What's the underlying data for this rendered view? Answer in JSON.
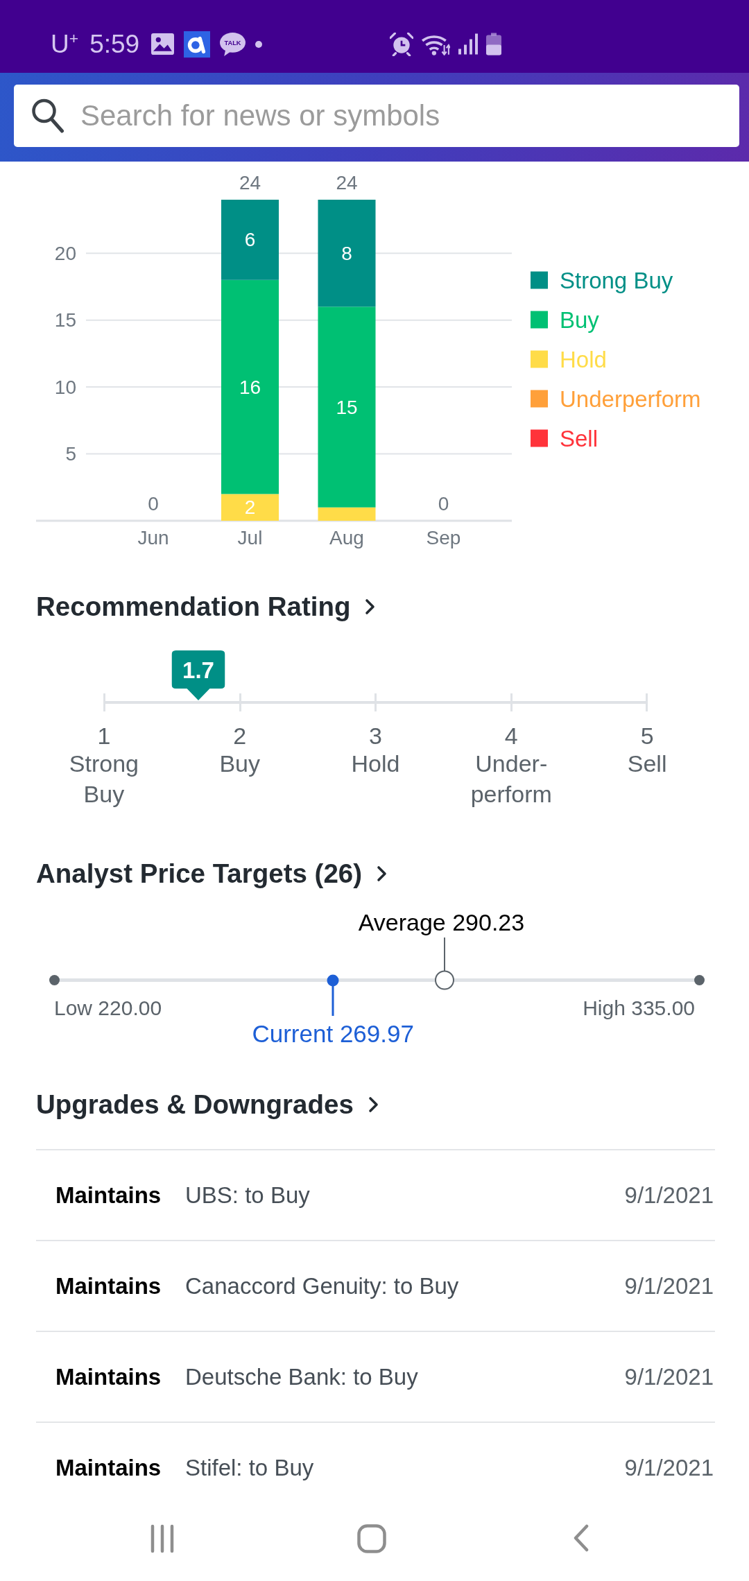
{
  "status_bar": {
    "carrier": "U$^{+}$",
    "time": "5:59",
    "chat_badge": "TALK"
  },
  "search": {
    "placeholder": "Search for news or symbols"
  },
  "recommendation_trends": {
    "totals": [
      "0",
      "24",
      "24",
      "0"
    ],
    "chart_data": {
      "type": "bar",
      "categories": [
        "Jun",
        "Jul",
        "Aug",
        "Sep"
      ],
      "series": [
        {
          "name": "Strong Buy",
          "color": "#008f86",
          "values": [
            0,
            6,
            8,
            0
          ]
        },
        {
          "name": "Buy",
          "color": "#00c073",
          "values": [
            0,
            16,
            15,
            0
          ]
        },
        {
          "name": "Hold",
          "color": "#ffdc48",
          "values": [
            0,
            2,
            1,
            0
          ]
        },
        {
          "name": "Underperform",
          "color": "#ffa03a",
          "values": [
            0,
            0,
            0,
            0
          ]
        },
        {
          "name": "Sell",
          "color": "#ff333a",
          "values": [
            0,
            0,
            0,
            0
          ]
        }
      ],
      "ylim": [
        0,
        24
      ],
      "yticks": [
        {
          "value": 5,
          "label": "5"
        },
        {
          "value": 10,
          "label": "10"
        },
        {
          "value": 15,
          "label": "15"
        },
        {
          "value": 20,
          "label": "20"
        }
      ],
      "stacked": true,
      "grid": true,
      "legend": true,
      "value_labels": [
        [
          null,
          "6",
          "8",
          null
        ],
        [
          null,
          "16",
          "15",
          null
        ],
        [
          null,
          "2",
          null,
          null
        ],
        [
          null,
          null,
          null,
          null
        ],
        [
          null,
          null,
          null,
          null
        ]
      ]
    }
  },
  "recommendation_rating": {
    "title": "Recommendation Rating",
    "marker": {
      "value": "1.7",
      "level": 0.175
    },
    "scale": [
      {
        "number": "1",
        "label": "Strong Buy"
      },
      {
        "number": "2",
        "label": "Buy"
      },
      {
        "number": "3",
        "label": "Hold"
      },
      {
        "number": "4",
        "label": "Under-perform"
      },
      {
        "number": "5",
        "label": "Sell"
      }
    ]
  },
  "price_targets": {
    "title": "Analyst Price Targets (26)",
    "average": {
      "label": "Average 290.23",
      "level": 0.605
    },
    "current": {
      "label": "Current 269.97",
      "level": 0.432
    },
    "low": "Low 220.00",
    "high": "High 335.00"
  },
  "upgrades_downgrades": {
    "title": "Upgrades & Downgrades",
    "rows": [
      {
        "action": "Maintains",
        "firm": "UBS: to Buy",
        "date": "9/1/2021"
      },
      {
        "action": "Maintains",
        "firm": "Canaccord Genuity: to Buy",
        "date": "9/1/2021"
      },
      {
        "action": "Maintains",
        "firm": "Deutsche Bank: to Buy",
        "date": "9/1/2021"
      },
      {
        "action": "Maintains",
        "firm": "Stifel: to Buy",
        "date": "9/1/2021"
      }
    ]
  }
}
